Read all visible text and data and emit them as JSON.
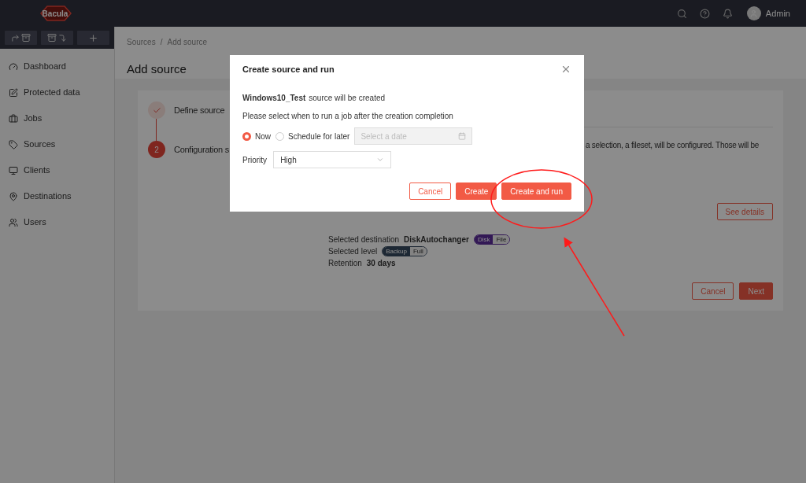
{
  "top_bar": {
    "logo": "Bacula",
    "user": "Admin"
  },
  "sidebar": {
    "toolbar": [
      {
        "kind": "send"
      },
      {
        "kind": "receive"
      },
      {
        "kind": "add"
      }
    ],
    "items": [
      {
        "label": "Dashboard",
        "kind": "dashboard"
      },
      {
        "label": "Protected data",
        "kind": "protected"
      },
      {
        "label": "Jobs",
        "kind": "jobs"
      },
      {
        "label": "Sources",
        "kind": "sources"
      },
      {
        "label": "Clients",
        "kind": "clients"
      },
      {
        "label": "Destinations",
        "kind": "destinations"
      },
      {
        "label": "Users",
        "kind": "users"
      }
    ]
  },
  "breadcrumb": {
    "items": [
      "Sources",
      "Add source"
    ],
    "separator": "/"
  },
  "page_title": "Add source",
  "steps": [
    {
      "label": "Define source",
      "done": true
    },
    {
      "label": "Configuration s",
      "done": false,
      "number": "2"
    }
  ],
  "description": "a selection, a fileset, will be configured. Those will be",
  "see_details": "See details",
  "details": [
    {
      "label": "Selected destination",
      "value": "DiskAutochanger",
      "tags": [
        "Disk",
        "File"
      ],
      "color": "#321856"
    },
    {
      "label": "Selected level",
      "tags": [
        "Backup",
        "Full"
      ],
      "color": "#1d2834"
    },
    {
      "label": "Retention",
      "value": "30 days"
    }
  ],
  "footer_buttons": [
    {
      "label": "Cancel",
      "kind": "secondary"
    },
    {
      "label": "Next",
      "kind": "primary"
    }
  ],
  "dialog": {
    "title": "Create source and run",
    "source_name": "Windows10_Test",
    "source_text": "source will be created",
    "prompt": "Please select when to run a job after the creation completion",
    "run_options": [
      {
        "label": "Now",
        "selected": true
      },
      {
        "label": "Schedule for later",
        "selected": false
      }
    ],
    "date": {
      "placeholder": "Select a date",
      "disabled": true
    },
    "priority": {
      "label": "Priority",
      "value": "High"
    },
    "buttons": [
      {
        "label": "Cancel",
        "kind": "secondary"
      },
      {
        "label": "Create",
        "kind": "primary"
      },
      {
        "label": "Create and run",
        "kind": "primary"
      }
    ]
  },
  "annotation": {
    "highlight": true
  }
}
